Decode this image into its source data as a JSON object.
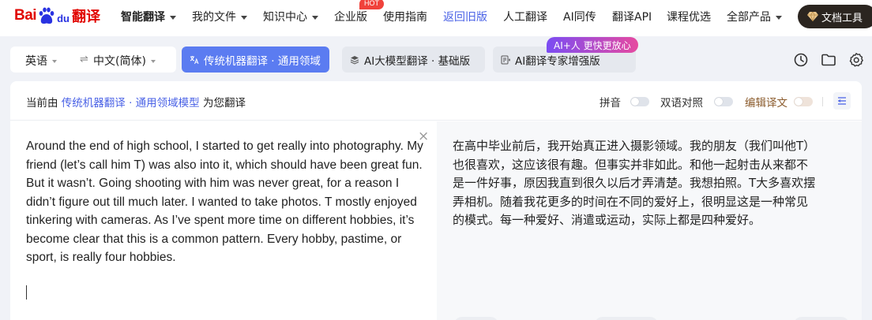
{
  "logo": {
    "bai": "Bai",
    "du": "du",
    "fanyi": "翻译"
  },
  "nav": {
    "items": [
      {
        "label": "智能翻译"
      },
      {
        "label": "我的文件"
      },
      {
        "label": "知识中心"
      },
      {
        "label": "企业版"
      },
      {
        "label": "使用指南"
      },
      {
        "label": "返回旧版"
      },
      {
        "label": "人工翻译"
      },
      {
        "label": "AI同传"
      },
      {
        "label": "翻译API"
      },
      {
        "label": "课程优选"
      },
      {
        "label": "全部产品"
      }
    ],
    "hot_badge": "HOT",
    "doc_tools": "文档工具"
  },
  "toolbar": {
    "source_lang": "英语",
    "swap_icon": "⇌",
    "target_lang": "中文(简体)",
    "modes": [
      {
        "label": "传统机器翻译 · 通用领域"
      },
      {
        "label": "AI大模型翻译 · 基础版"
      },
      {
        "label": "AI翻译专家增强版"
      }
    ],
    "ai_badge": "AI+人 更快更放心",
    "icons": [
      "history-icon",
      "folder-icon",
      "settings-icon"
    ]
  },
  "panel": {
    "engine_prefix": "当前由",
    "engine_link": "传统机器翻译 · 通用领域模型",
    "engine_suffix": "为您翻译",
    "pinyin_label": "拼音",
    "bilingual_label": "双语对照",
    "edit_label": "编辑译文",
    "clear_icon": "×",
    "source_text": "Around the end of high school, I started to get really into photography. My friend (let’s call him T) was also into it, which should have been great fun. But it wasn’t. Going shooting with him was never great, for a reason I didn’t figure out till much later. I wanted to take photos. T mostly enjoyed tinkering with cameras. As I’ve spent more time on different hobbies, it’s become clear that this is a common pattern. Every hobby, pastime, or sport, is really four hobbies.",
    "target_text": "在高中毕业前后，我开始真正进入摄影领域。我的朋友（我们叫他T）也很喜欢，这应该很有趣。但事实并非如此。和他一起射击从来都不是一件好事，原因我直到很久以后才弄清楚。我想拍照。T大多喜欢摆弄相机。随着我花更多的时间在不同的爱好上，很明显这是一种常见的模式。每一种爱好、消遣或运动，实际上都是四种爱好。"
  },
  "colors": {
    "accent": "#5b7cf1",
    "brand_red": "#e10601",
    "brand_blue": "#2932e1",
    "link": "#4a62e6"
  }
}
